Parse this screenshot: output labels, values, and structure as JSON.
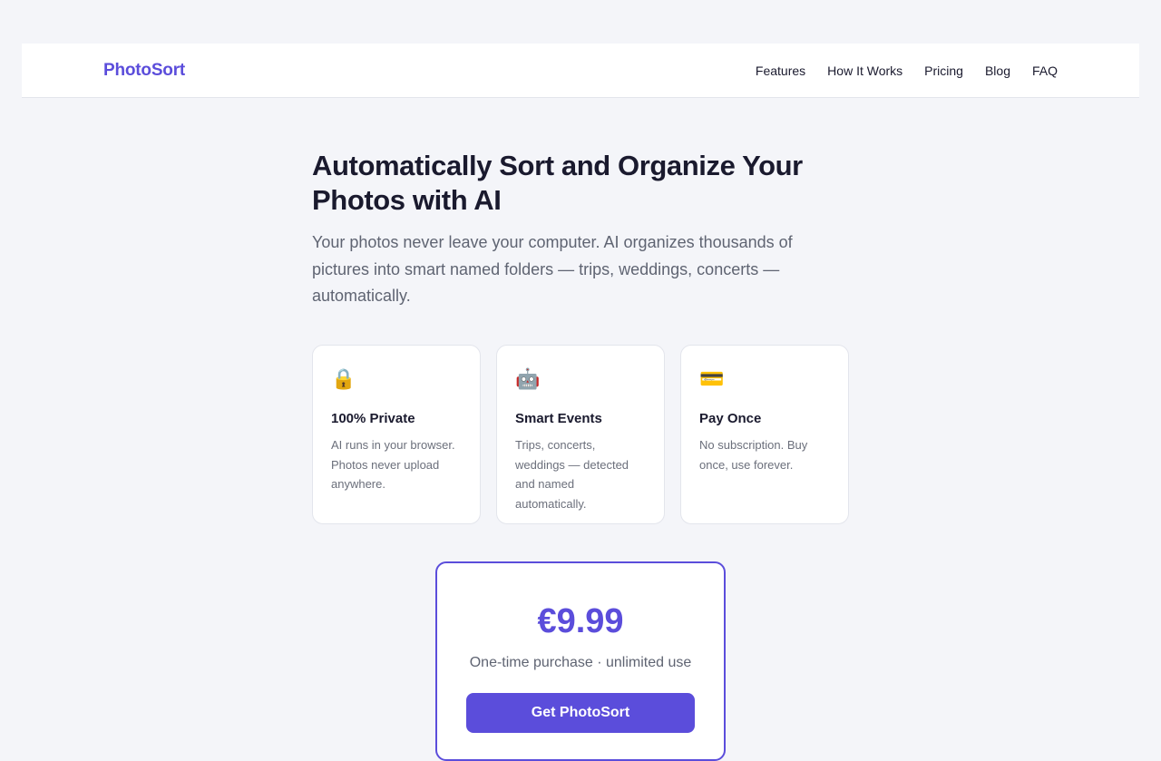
{
  "header": {
    "brand": "PhotoSort",
    "nav": [
      "Features",
      "How It Works",
      "Pricing",
      "Blog",
      "FAQ"
    ]
  },
  "hero": {
    "title": "Automatically Sort and Organize Your Photos with AI",
    "subtitle": "Your photos never leave your computer. AI organizes thousands of pictures into smart named folders — trips, weddings, concerts — automatically."
  },
  "features": [
    {
      "icon": "lock-icon",
      "glyph": "🔒",
      "title": "100% Private",
      "text": "AI runs in your browser. Photos never upload anywhere."
    },
    {
      "icon": "robot-icon",
      "glyph": "🤖",
      "title": "Smart Events",
      "text": "Trips, concerts, weddings — detected and named automatically."
    },
    {
      "icon": "credit-card-icon",
      "glyph": "💳",
      "title": "Pay Once",
      "text": "No subscription. Buy once, use forever."
    }
  ],
  "pricing": {
    "price": "€9.99",
    "note": "One-time purchase · unlimited use",
    "cta": "Get PhotoSort"
  },
  "colors": {
    "accent": "#5b4ddb",
    "background": "#f4f5f9",
    "text": "#1a1a2e",
    "muted": "#5f6472"
  }
}
